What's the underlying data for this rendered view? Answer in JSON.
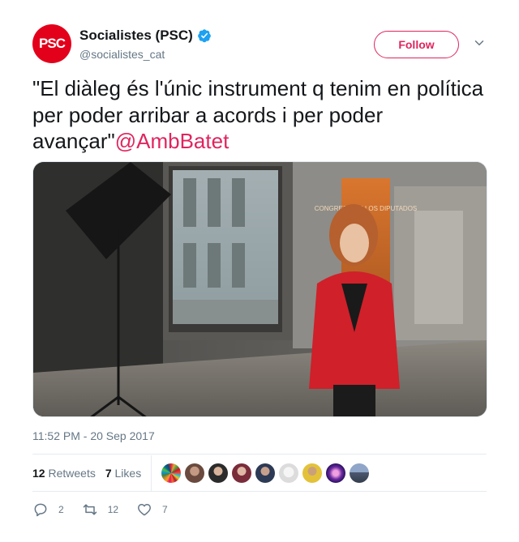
{
  "author": {
    "avatar_text": "PSC",
    "display_name": "Socialistes (PSC)",
    "handle": "@socialistes_cat",
    "verified": true
  },
  "follow_label": "Follow",
  "tweet": {
    "text": "\"El diàleg és l'únic instrument q tenim en política per poder arribar a acords i per poder avançar\"",
    "mention": "@AmbBatet"
  },
  "media": {
    "sign_text": "CONGRESO DE LOS DIPUTADOS"
  },
  "timestamp": "11:52 PM - 20 Sep 2017",
  "stats": {
    "retweets_count": "12",
    "retweets_label": "Retweets",
    "likes_count": "7",
    "likes_label": "Likes"
  },
  "actions": {
    "replies": "2",
    "retweets": "12",
    "likes": "7"
  },
  "colors": {
    "brand": "#e0245e",
    "avatar_bg": "#e3001b",
    "verified": "#1da1f2",
    "muted": "#657786"
  },
  "icons": [
    "verified-badge-icon",
    "chevron-down-icon",
    "reply-icon",
    "retweet-icon",
    "like-icon"
  ]
}
